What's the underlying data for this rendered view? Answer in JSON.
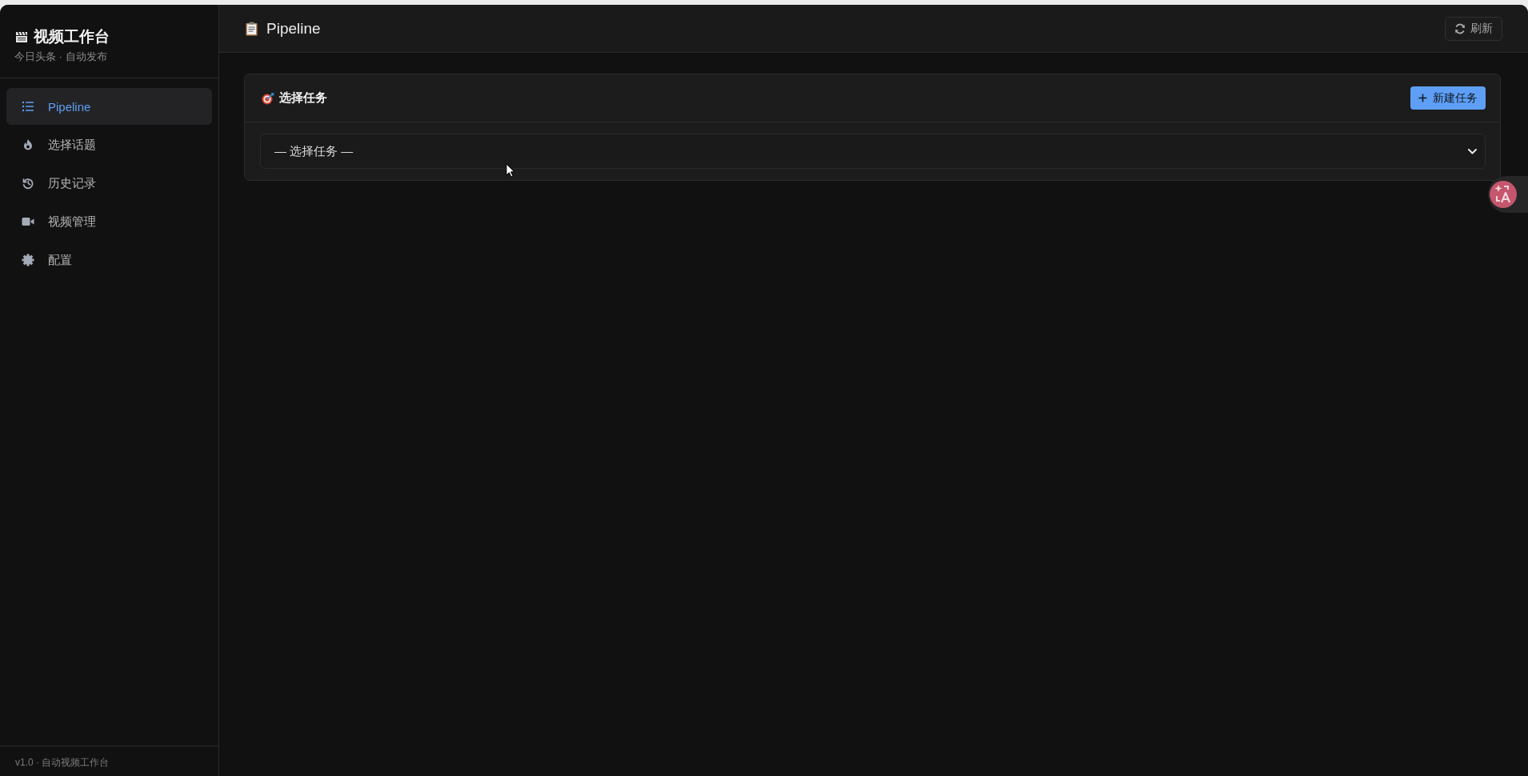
{
  "sidebar": {
    "brand": {
      "title": "视频工作台",
      "subtitle": "今日头条 · 自动发布"
    },
    "nav_items": [
      {
        "label": "Pipeline",
        "selected": true
      },
      {
        "label": "选择话题",
        "selected": false
      },
      {
        "label": "历史记录",
        "selected": false
      },
      {
        "label": "视频管理",
        "selected": false
      },
      {
        "label": "配置",
        "selected": false
      }
    ],
    "footer": "v1.0 · 自动视频工作台"
  },
  "header": {
    "title": "Pipeline",
    "refresh_button": "刷新"
  },
  "task_card": {
    "title": "选择任务",
    "new_task_button": "新建任务",
    "task_select": {
      "value": "— 选择任务 —"
    }
  }
}
